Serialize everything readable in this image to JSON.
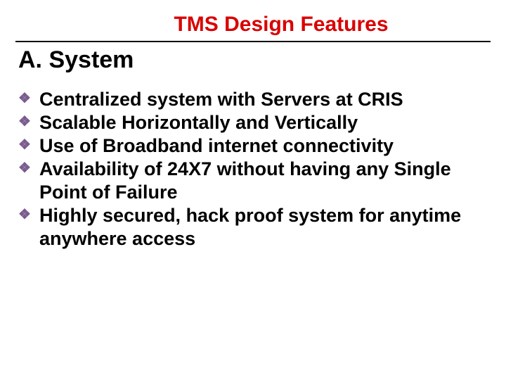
{
  "title": "TMS Design Features",
  "section": "A.   System",
  "bullets": [
    "Centralized system with Servers at CRIS",
    "Scalable Horizontally and Vertically",
    "Use of Broadband internet connectivity",
    "Availability of 24X7 without having any Single Point of Failure",
    "Highly secured, hack proof system for anytime anywhere access"
  ]
}
